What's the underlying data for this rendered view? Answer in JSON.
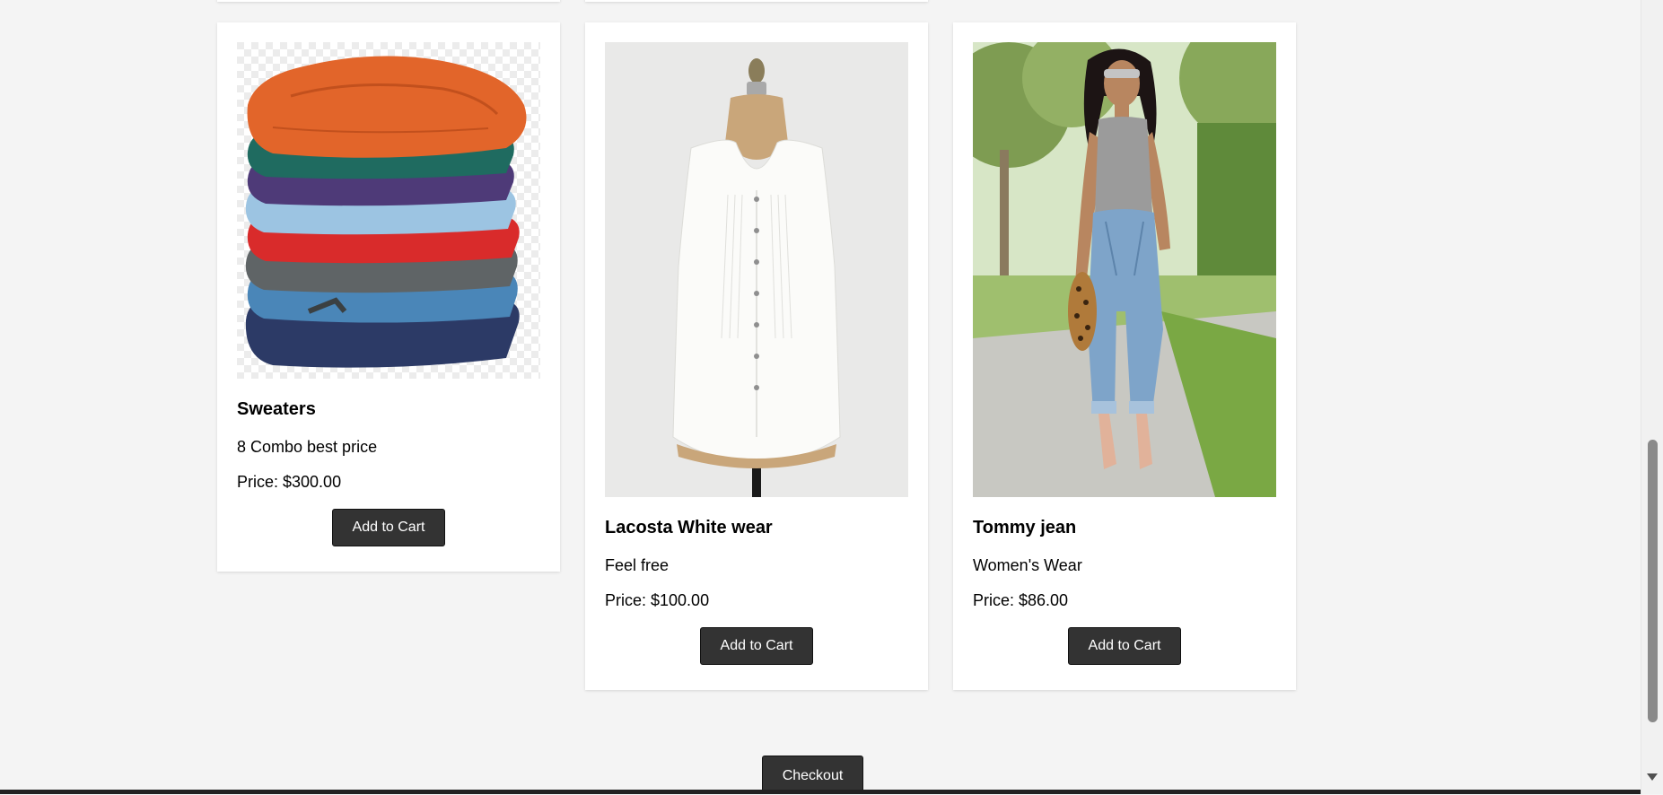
{
  "products": [
    {
      "name": "Sweaters",
      "description": "8 Combo best price",
      "price": "Price: $300.00",
      "button_label": "Add to Cart"
    },
    {
      "name": "Lacosta White wear",
      "description": "Feel free",
      "price": "Price: $100.00",
      "button_label": "Add to Cart"
    },
    {
      "name": "Tommy jean",
      "description": "Women's Wear",
      "price": "Price: $86.00",
      "button_label": "Add to Cart"
    }
  ],
  "checkout": {
    "label": "Checkout"
  }
}
